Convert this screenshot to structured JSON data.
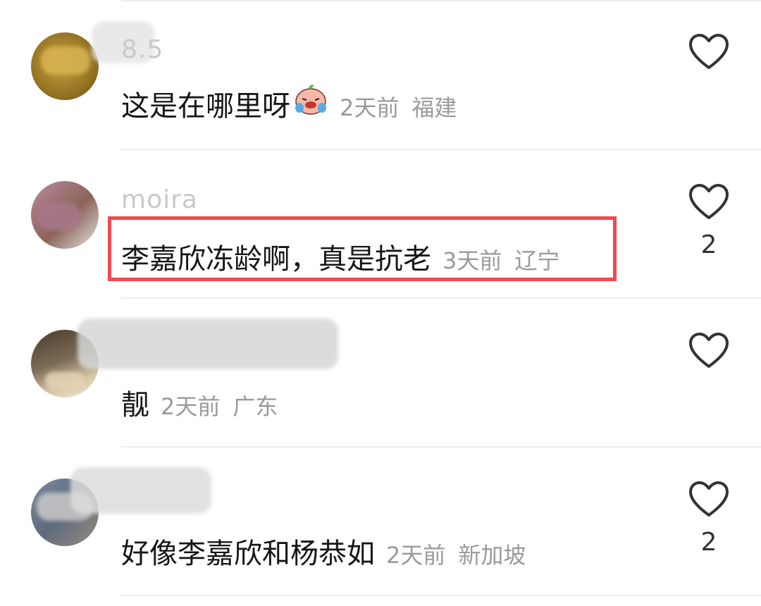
{
  "comments": [
    {
      "username": "8.5",
      "text": "这是在哪里呀",
      "emoji": "crying-face-emoji",
      "time": "2天前",
      "location": "福建",
      "likes": ""
    },
    {
      "username": "moira",
      "text": "李嘉欣冻龄啊，真是抗老",
      "time": "3天前",
      "location": "辽宁",
      "likes": "2",
      "highlighted": true
    },
    {
      "username": "",
      "text": "靓",
      "time": "2天前",
      "location": "广东",
      "likes": ""
    },
    {
      "username": "",
      "text": "好像李嘉欣和杨恭如",
      "time": "2天前",
      "location": "新加坡",
      "likes": "2"
    }
  ],
  "colors": {
    "highlight_border": "#f24a4f",
    "meta_text": "#9a9a9a",
    "divider": "#ececec"
  }
}
